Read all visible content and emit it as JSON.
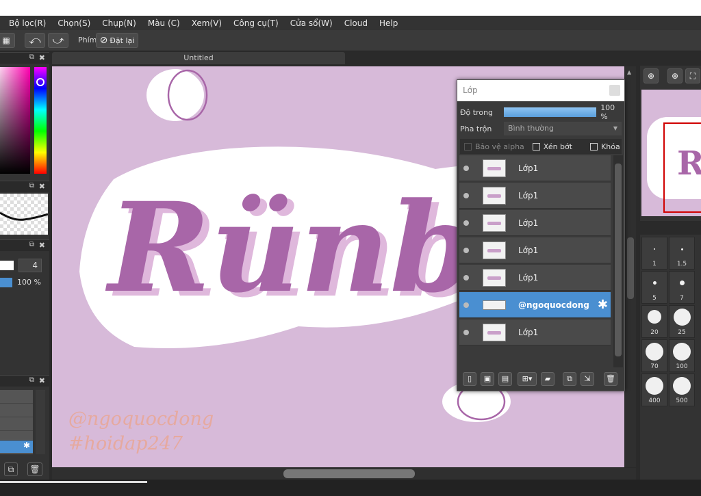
{
  "menu": [
    "Bộ lọc(R)",
    "Chọn(S)",
    "Chụp(N)",
    "Màu (C)",
    "Xem(V)",
    "Công cụ(T)",
    "Cửa sổ(W)",
    "Cloud",
    "Help"
  ],
  "toolbar": {
    "phim_label": "Phím",
    "reset_label": "Đặt lại"
  },
  "document": {
    "tab_title": "Untitled"
  },
  "canvas": {
    "lettering": "Rünbh",
    "watermark_1": "@ngoquocdong",
    "watermark_2": "#hoidap247"
  },
  "brush_panel": {
    "size_value": "4",
    "opacity_value": "100 %"
  },
  "layers": {
    "title": "Lớp",
    "opacity_label": "Độ trong",
    "opacity_value": "100 %",
    "opacity_fraction": 1.0,
    "blend_label": "Pha trộn",
    "blend_value": "Bình thường",
    "protect_alpha": "Bảo vệ alpha",
    "clipping": "Xén bớt",
    "lock": "Khóa",
    "items": [
      {
        "name": "Lớp1",
        "selected": false
      },
      {
        "name": "Lớp1",
        "selected": false
      },
      {
        "name": "Lớp1",
        "selected": false
      },
      {
        "name": "Lớp1",
        "selected": false
      },
      {
        "name": "Lớp1",
        "selected": false
      },
      {
        "name": "@ngoquocdong",
        "selected": true
      },
      {
        "name": "Lớp1",
        "selected": false
      }
    ]
  },
  "brush_sizes": [
    "1",
    "1.5",
    "5",
    "7",
    "20",
    "25",
    "70",
    "100",
    "400",
    "500"
  ],
  "colors": {
    "canvas_bg": "#d7bad9",
    "lettering": "#a866a8",
    "selection": "#4a8fd1",
    "watermark": "#e8a899"
  }
}
